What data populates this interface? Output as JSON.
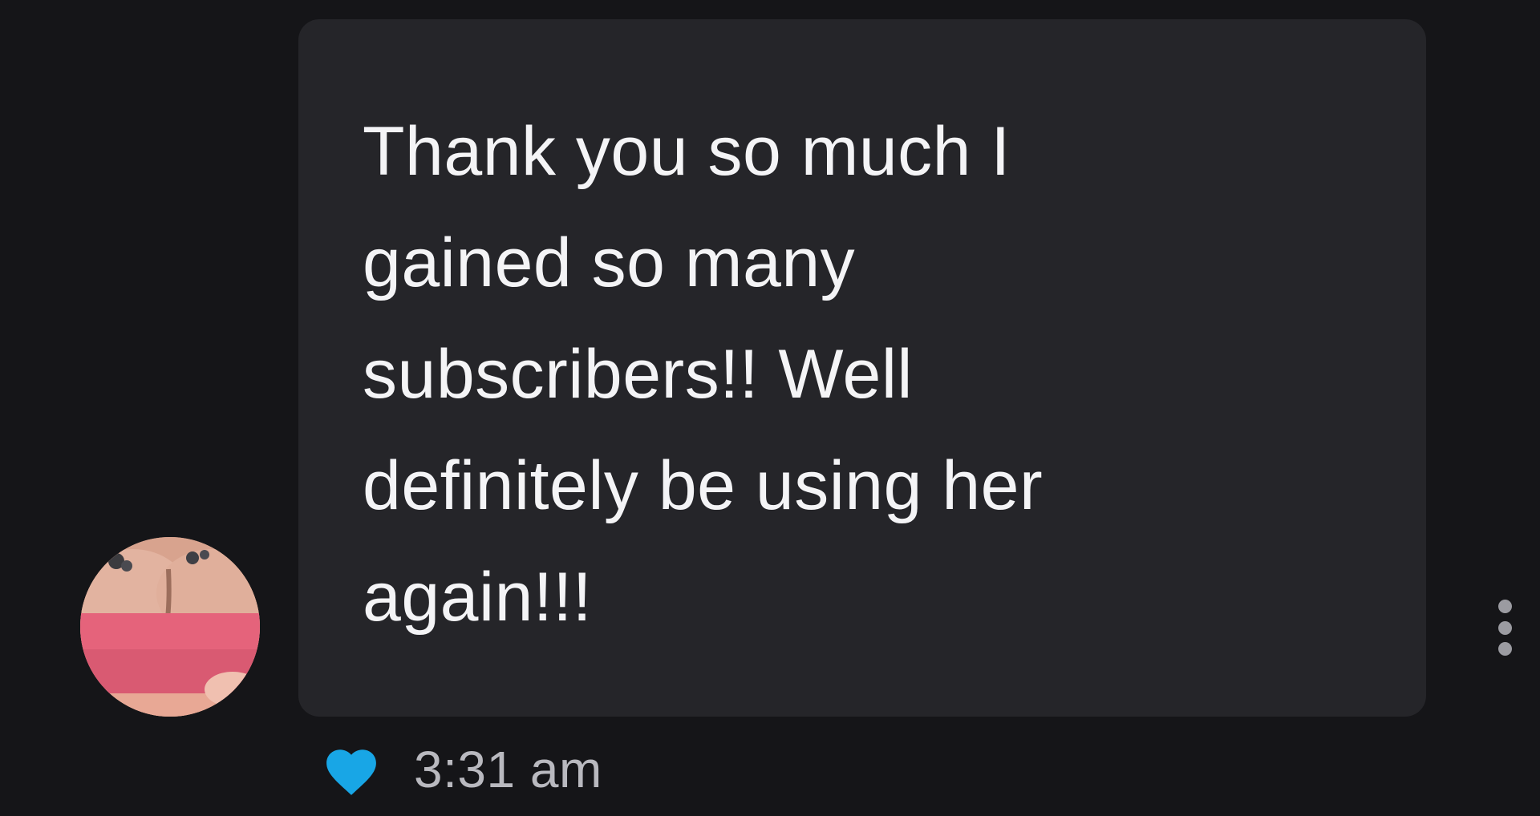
{
  "message": {
    "text": "Thank you so much I gained so many subscribers!! Well definitely be using her again!!!",
    "timestamp": "3:31 am",
    "liked": true
  },
  "icons": {
    "like": "heart-icon",
    "more": "more-vertical-icon",
    "avatar": "sender-avatar"
  },
  "colors": {
    "background": "#151518",
    "bubble": "#252529",
    "message_text": "#f4f4f6",
    "timestamp": "#b9b9bf",
    "heart": "#18a6e6",
    "menu_dots": "#9b9ba1"
  }
}
